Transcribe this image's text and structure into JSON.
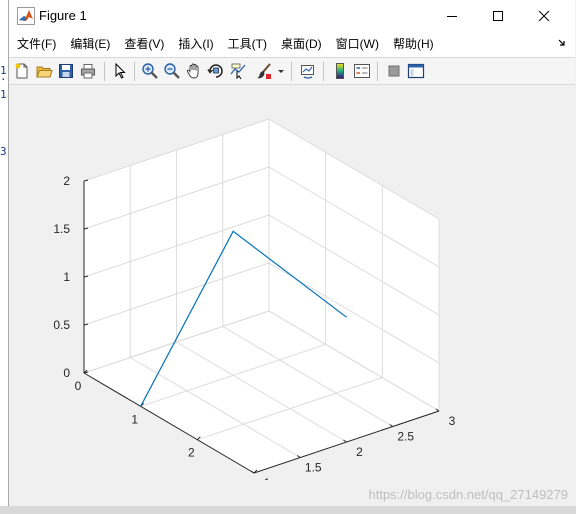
{
  "window": {
    "title": "Figure 1"
  },
  "menubar": {
    "items": [
      {
        "label": "文件(F)"
      },
      {
        "label": "编辑(E)"
      },
      {
        "label": "查看(V)"
      },
      {
        "label": "插入(I)"
      },
      {
        "label": "工具(T)"
      },
      {
        "label": "桌面(D)"
      },
      {
        "label": "窗口(W)"
      },
      {
        "label": "帮助(H)"
      }
    ]
  },
  "background_fragments": {
    "lines": [
      ".",
      "1",
      "1",
      "3,"
    ]
  },
  "watermark": "https://blog.csdn.net/qq_27149279",
  "colors": {
    "line": "#0072bd",
    "grid": "#dcdcdc",
    "axis": "#262626",
    "plot_bg": "#ffffff"
  },
  "chart_data": {
    "type": "line3d",
    "series": [
      {
        "x": [
          1,
          1,
          3
        ],
        "y": [
          1,
          2,
          2
        ],
        "z": [
          0,
          1.5,
          1.3
        ]
      }
    ],
    "xlim": [
      0,
      3
    ],
    "ylim": [
      1,
      3
    ],
    "zlim": [
      0,
      2
    ],
    "x_ticks": [
      "0",
      "1",
      "2",
      "3"
    ],
    "y_ticks": [
      "1",
      "1.5",
      "2",
      "2.5",
      "3"
    ],
    "z_ticks": [
      "0",
      "0.5",
      "1",
      "1.5",
      "2"
    ],
    "grid": true
  }
}
